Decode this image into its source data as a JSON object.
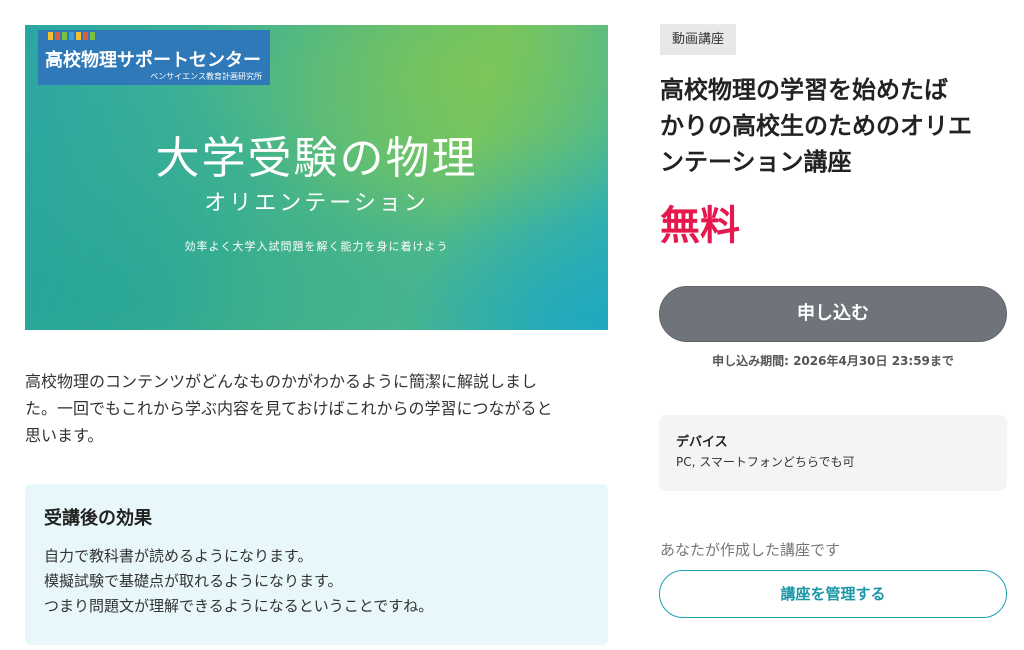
{
  "hero": {
    "brand_title": "高校物理サポートセンター",
    "brand_subtitle": "ペンサイエンス教育計画研究所",
    "brand_bar_colors": [
      "#f2c230",
      "#e25b3c",
      "#7ac143",
      "#3aa0d8",
      "#f2c230",
      "#e25b3c",
      "#7ac143"
    ],
    "title": "大学受験の物理",
    "subtitle": "オリエンテーション",
    "tagline": "効率よく大学入試問題を解く能力を身に着けよう"
  },
  "description": {
    "lines": [
      "高校物理のコンテンツがどんなものかがわかるように簡潔に解説しまし",
      "た。一回でもこれから学ぶ内容を見ておけばこれからの学習につながると",
      "思います。"
    ]
  },
  "effects": {
    "heading": "受講後の効果",
    "lines": [
      "自力で教科書が読めるようになります。",
      "模擬試験で基礎点が取れるようになります。",
      "つまり問題文が理解できるようになるということですね。"
    ]
  },
  "sidebar": {
    "tag": "動画講座",
    "title_lines": [
      "高校物理の学習を始めたば",
      "かりの高校生のためのオリエ",
      "ンテーション講座"
    ],
    "price": "無料",
    "apply_label": "申し込む",
    "deadline": "申し込み期間: 2026年4月30日 23:59まで",
    "device_label": "デバイス",
    "device_value": "PC, スマートフォンどちらでも可",
    "owner_note": "あなたが作成した講座です",
    "manage_label": "講座を管理する"
  },
  "colors": {
    "price": "#e6194f",
    "apply_button": "#6f747a",
    "manage_accent": "#1a96a6",
    "effects_bg": "#e8f7fa"
  }
}
